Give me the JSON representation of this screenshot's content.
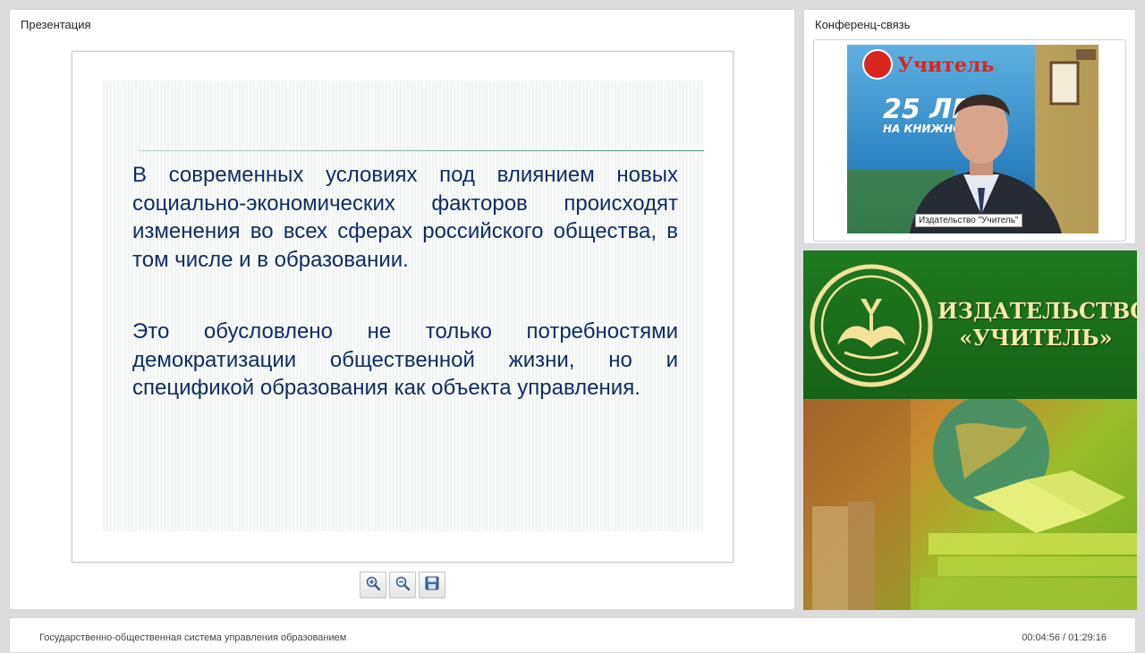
{
  "presentation": {
    "title": "Презентация",
    "slide": {
      "paragraph_1": "В современных условиях под влиянием новых социально-экономических факторов происходят изменения во всех сферах российского общества, в том числе и в образовании.",
      "paragraph_2": "Это обусловлено не только потребностями демократизации общественной жизни, но и спецификой образования как объекта управления."
    },
    "toolbar": {
      "zoom_in_icon": "zoom-in-icon",
      "zoom_out_icon": "zoom-out-icon",
      "save_icon": "save-icon"
    }
  },
  "conference": {
    "title": "Конференц-связь",
    "video_caption": "Издательство \"Учитель\"",
    "poster_text": {
      "brand": "Учитель",
      "years": "25 ЛЕ",
      "line": "НА КНИЖНОМ"
    }
  },
  "banner": {
    "line1": "ИЗДАТЕЛЬСТВО",
    "line2": "«УЧИТЕЛЬ»"
  },
  "footer": {
    "course_title": "Государственно-общественная система управления образованием",
    "time": "00:04:56 / 01:29:16"
  },
  "colors": {
    "slide_text": "#0f2d63",
    "banner_green": "#1f7a1f",
    "banner_text": "#f7eaa6"
  }
}
